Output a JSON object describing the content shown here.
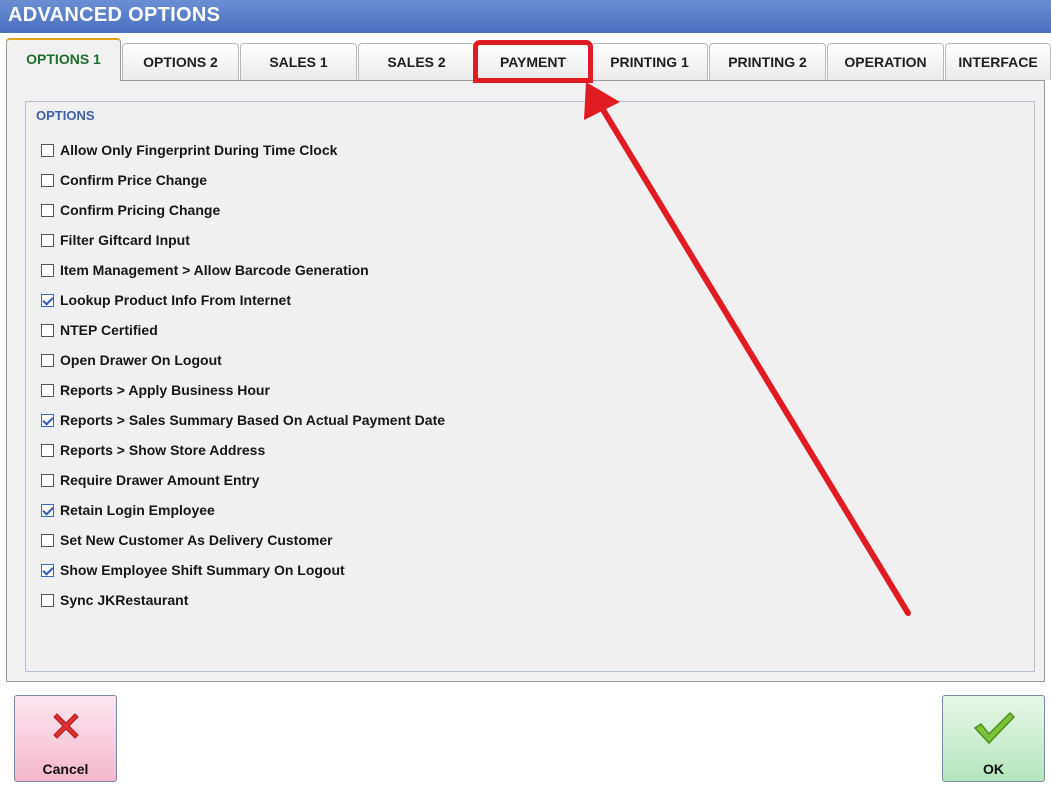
{
  "window": {
    "title": "ADVANCED OPTIONS"
  },
  "tabs": [
    {
      "label": "OPTIONS 1",
      "active": true
    },
    {
      "label": "OPTIONS 2"
    },
    {
      "label": "SALES 1"
    },
    {
      "label": "SALES 2"
    },
    {
      "label": "PAYMENT",
      "highlighted": true
    },
    {
      "label": "PRINTING 1"
    },
    {
      "label": "PRINTING 2"
    },
    {
      "label": "OPERATION"
    },
    {
      "label": "INTERFACE"
    }
  ],
  "group": {
    "title": "OPTIONS"
  },
  "options": [
    {
      "label": "Allow Only Fingerprint During Time Clock",
      "checked": false
    },
    {
      "label": "Confirm Price Change",
      "checked": false
    },
    {
      "label": "Confirm Pricing Change",
      "checked": false
    },
    {
      "label": "Filter Giftcard Input",
      "checked": false
    },
    {
      "label": "Item Management > Allow Barcode Generation",
      "checked": false
    },
    {
      "label": "Lookup Product Info From Internet",
      "checked": true
    },
    {
      "label": "NTEP Certified",
      "checked": false
    },
    {
      "label": "Open Drawer On Logout",
      "checked": false
    },
    {
      "label": "Reports > Apply Business Hour",
      "checked": false
    },
    {
      "label": "Reports > Sales Summary Based On Actual Payment Date",
      "checked": true
    },
    {
      "label": "Reports > Show Store Address",
      "checked": false
    },
    {
      "label": "Require Drawer Amount Entry",
      "checked": false
    },
    {
      "label": "Retain Login Employee",
      "checked": true
    },
    {
      "label": "Set New Customer As Delivery Customer",
      "checked": false
    },
    {
      "label": "Show Employee Shift Summary On Logout",
      "checked": true
    },
    {
      "label": "Sync JKRestaurant",
      "checked": false
    }
  ],
  "buttons": {
    "cancel": "Cancel",
    "ok": "OK"
  },
  "icons": {
    "cancel": "x-icon",
    "ok": "checkmark-icon"
  },
  "colors": {
    "titlebar": "#4a70c0",
    "active_tab_text": "#1b6e2a",
    "highlight": "#e01b22",
    "group_title": "#3c5fa6"
  }
}
